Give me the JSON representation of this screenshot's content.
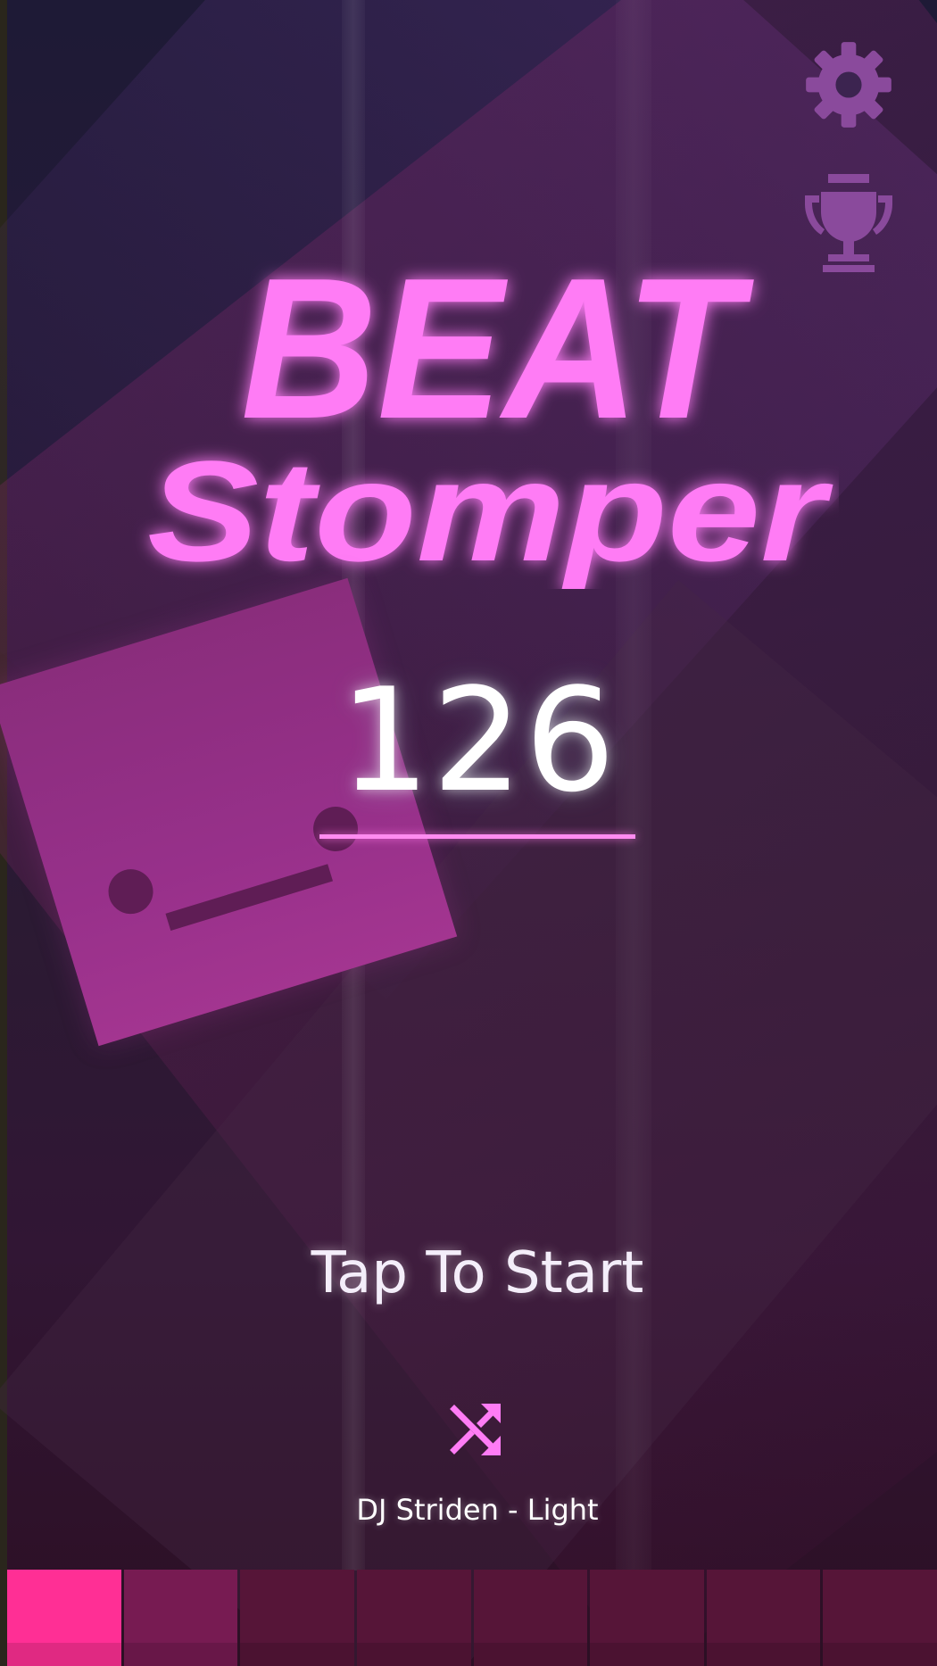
{
  "title": {
    "line1": "BEAT",
    "line2": "Stomper"
  },
  "score": "126",
  "tap_to_start": "Tap To Start",
  "song": "DJ Striden - Light",
  "icons": {
    "settings": "gear-icon",
    "leaderboard": "trophy-icon",
    "shuffle": "shuffle-icon"
  },
  "progress": {
    "segments_total": 8,
    "segments_filled": 1
  },
  "colors": {
    "title_pink": "#ff7cf5",
    "accent_pink": "#ff2f95",
    "icon_purple": "#8a4a9c",
    "cube_magenta": "#97308a"
  }
}
